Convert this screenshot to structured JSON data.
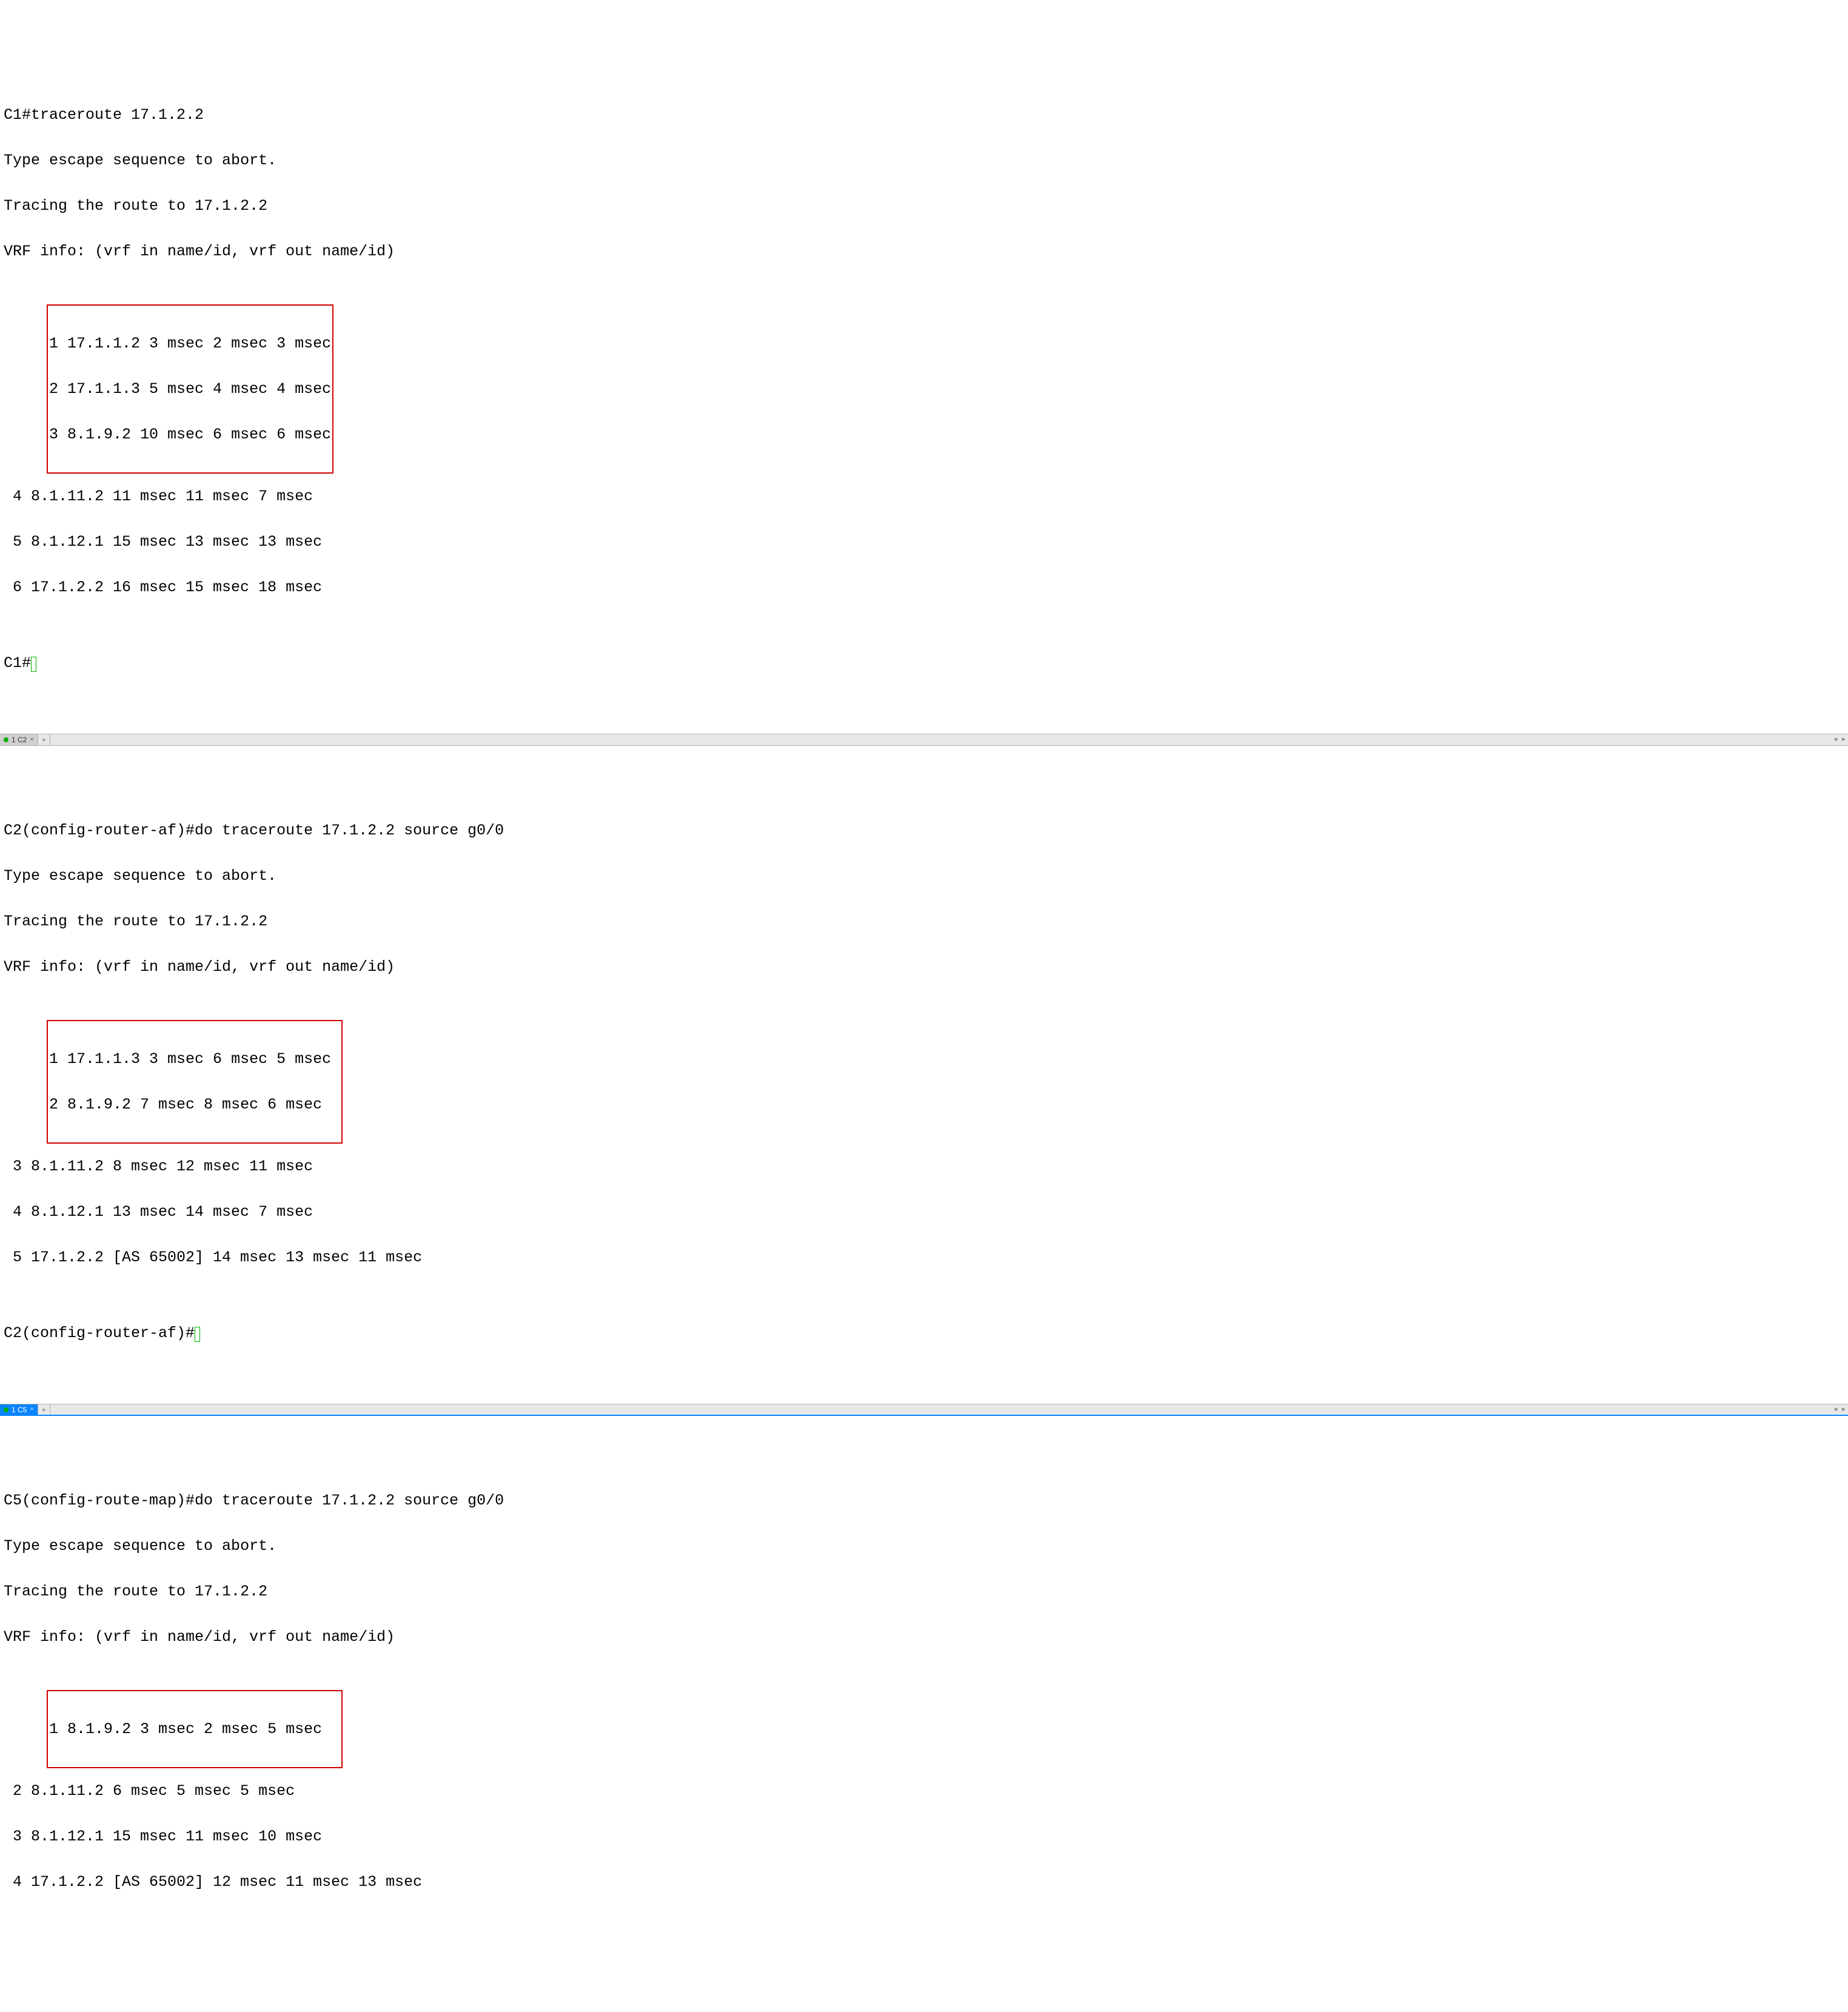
{
  "panel1": {
    "l1": "C1#traceroute 17.1.2.2",
    "l2": "Type escape sequence to abort.",
    "l3": "Tracing the route to 17.1.2.2",
    "l4": "VRF info: (vrf in name/id, vrf out name/id)",
    "hop1": "1 17.1.1.2 3 msec 2 msec 3 msec",
    "hop2": "2 17.1.1.3 5 msec 4 msec 4 msec",
    "hop3": "3 8.1.9.2 10 msec 6 msec 6 msec",
    "hop4": "4 8.1.11.2 11 msec 11 msec 7 msec",
    "hop5": "5 8.1.12.1 15 msec 13 msec 13 msec",
    "hop6": "6 17.1.2.2 16 msec 15 msec 18 msec",
    "prompt": "C1#"
  },
  "tab2": {
    "label": "1 C2",
    "close": "×",
    "add": "+"
  },
  "panel2": {
    "l1": "C2(config-router-af)#do traceroute 17.1.2.2 source g0/0",
    "l2": "Type escape sequence to abort.",
    "l3": "Tracing the route to 17.1.2.2",
    "l4": "VRF info: (vrf in name/id, vrf out name/id)",
    "hop1": "1 17.1.1.3 3 msec 6 msec 5 msec",
    "hop2": "2 8.1.9.2 7 msec 8 msec 6 msec  ",
    "hop3": "3 8.1.11.2 8 msec 12 msec 11 msec",
    "hop4": "4 8.1.12.1 13 msec 14 msec 7 msec",
    "hop5": "5 17.1.2.2 [AS 65002] 14 msec 13 msec 11 msec",
    "prompt": "C2(config-router-af)#"
  },
  "tab3": {
    "label": "1 C5",
    "close": "×",
    "add": "+"
  },
  "panel3": {
    "l1": "C5(config-route-map)#do traceroute 17.1.2.2 source g0/0",
    "l2": "Type escape sequence to abort.",
    "l3": "Tracing the route to 17.1.2.2",
    "l4": "VRF info: (vrf in name/id, vrf out name/id)",
    "hop1": "1 8.1.9.2 3 msec 2 msec 5 msec  ",
    "hop2": "2 8.1.11.2 6 msec 5 msec 5 msec",
    "hop3": "3 8.1.12.1 15 msec 11 msec 10 msec",
    "hop4": "4 17.1.2.2 [AS 65002] 12 msec 11 msec 13 msec"
  }
}
